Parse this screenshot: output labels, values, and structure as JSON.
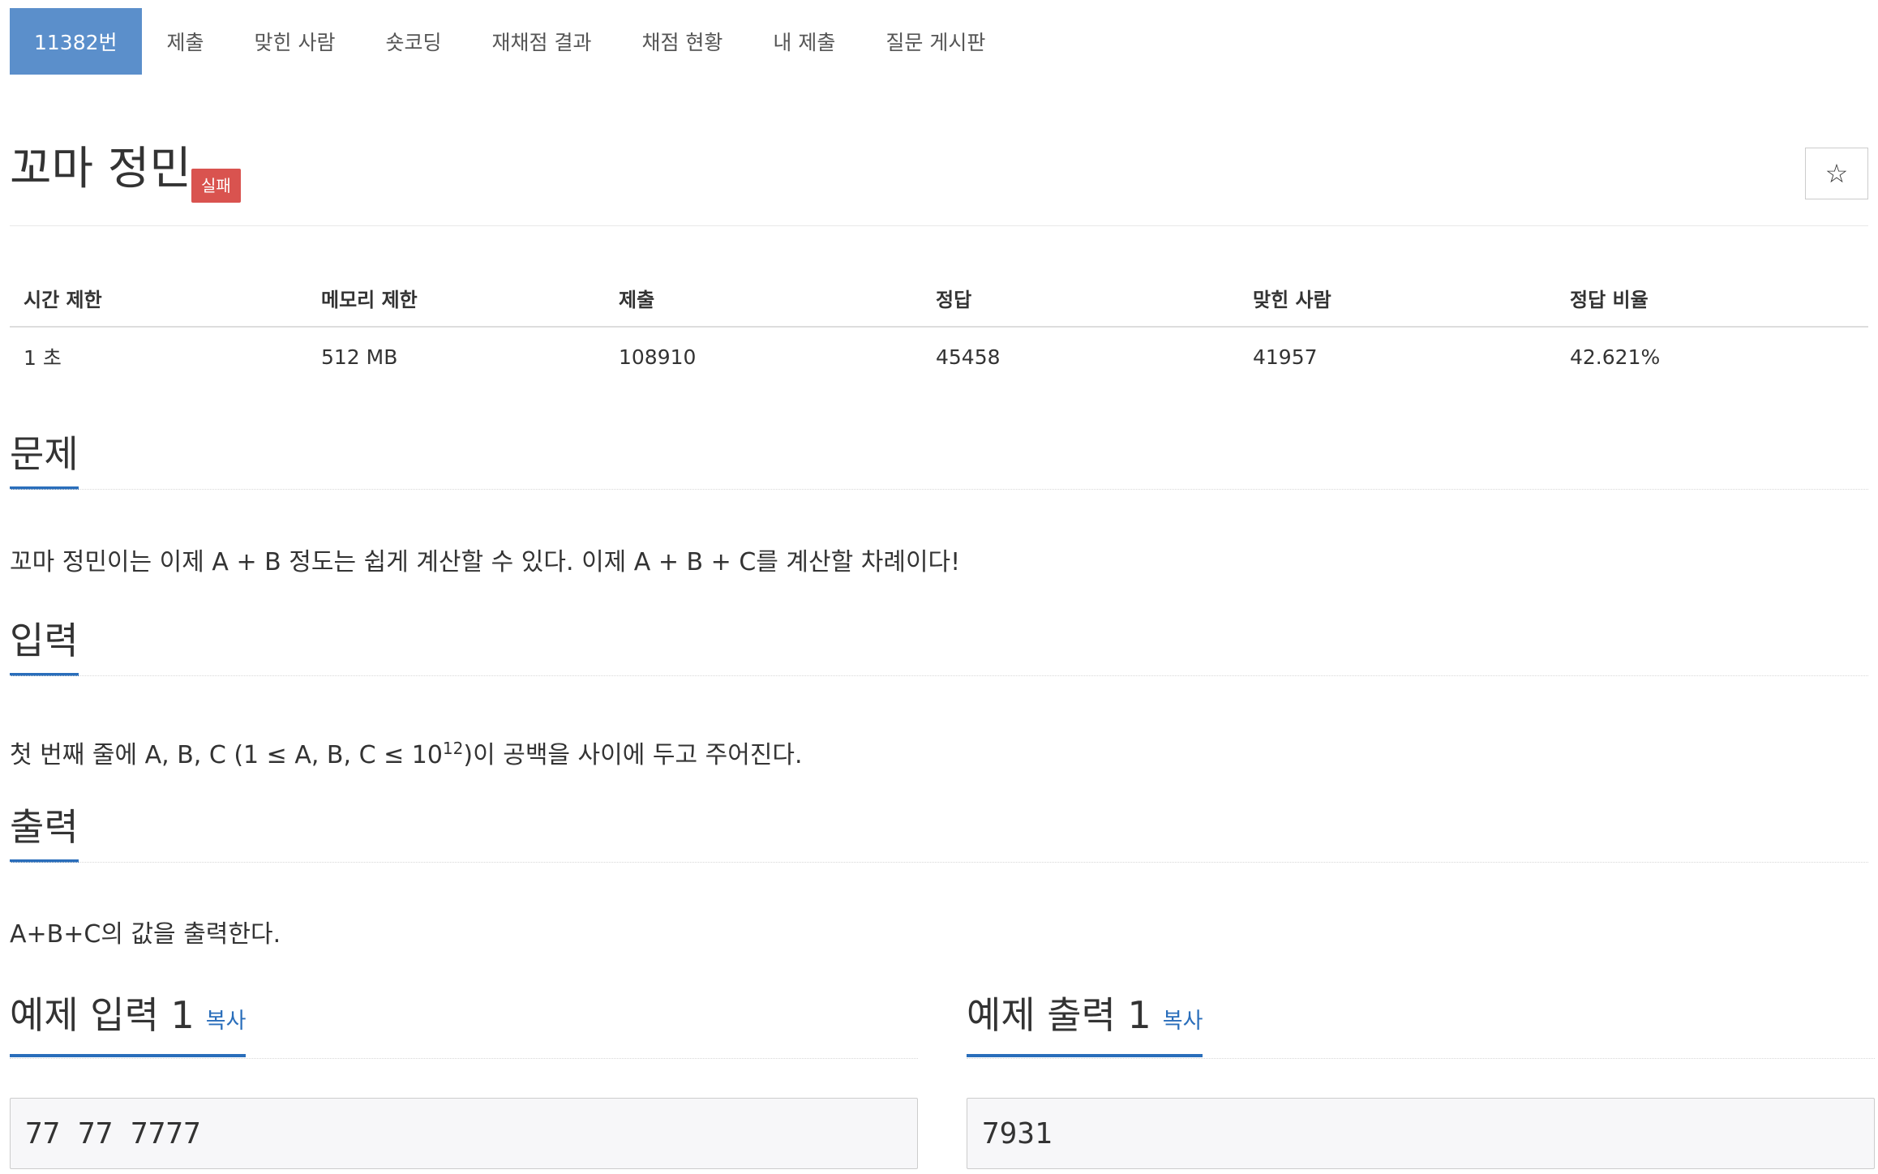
{
  "tabs": [
    {
      "label": "11382번",
      "active": true
    },
    {
      "label": "제출"
    },
    {
      "label": "맞힌 사람"
    },
    {
      "label": "숏코딩"
    },
    {
      "label": "재채점 결과"
    },
    {
      "label": "채점 현황"
    },
    {
      "label": "내 제출"
    },
    {
      "label": "질문 게시판"
    }
  ],
  "problem": {
    "title": "꼬마 정민",
    "status_badge": "실패",
    "star_icon": "☆"
  },
  "stats": {
    "headers": [
      "시간 제한",
      "메모리 제한",
      "제출",
      "정답",
      "맞힌 사람",
      "정답 비율"
    ],
    "values": [
      "1 초",
      "512 MB",
      "108910",
      "45458",
      "41957",
      "42.621%"
    ]
  },
  "sections": {
    "description": {
      "heading": "문제",
      "text": "꼬마 정민이는 이제 A + B 정도는 쉽게 계산할 수 있다. 이제 A + B + C를 계산할 차례이다!"
    },
    "input": {
      "heading": "입력",
      "text_before": "첫 번째 줄에 A, B, C (1 ≤ A, B, C ≤ 10",
      "text_sup": "12",
      "text_after": ")이 공백을 사이에 두고 주어진다."
    },
    "output": {
      "heading": "출력",
      "text": "A+B+C의 값을 출력한다."
    }
  },
  "samples": {
    "input": {
      "heading": "예제 입력 1",
      "copy_label": "복사",
      "content": "77 77 7777"
    },
    "output": {
      "heading": "예제 출력 1",
      "copy_label": "복사",
      "content": "7931"
    }
  },
  "colors": {
    "accent": "#2a6ebb",
    "active_tab": "#5b8fcb",
    "badge_fail": "#d9534f"
  }
}
